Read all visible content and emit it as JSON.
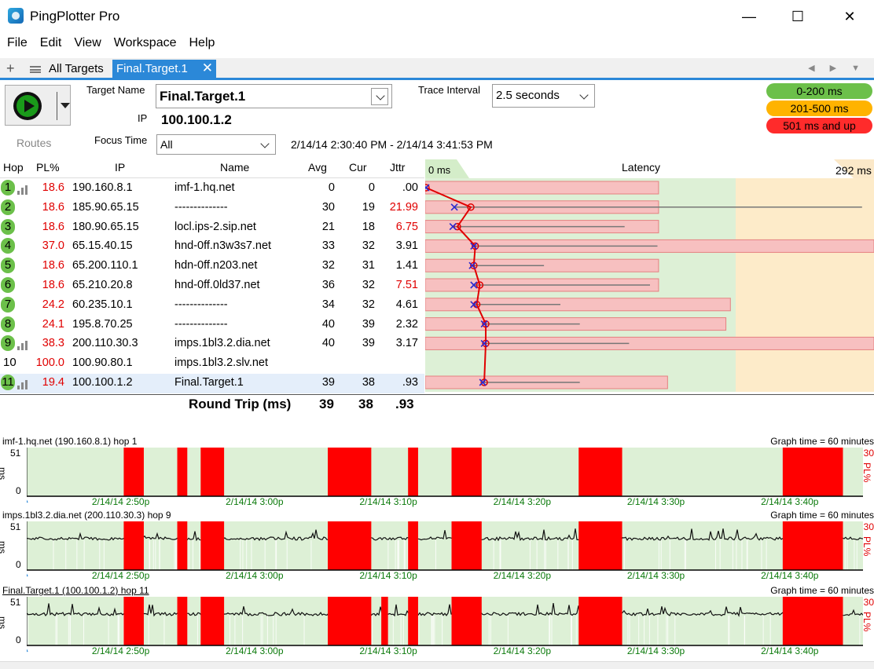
{
  "window": {
    "title": "PingPlotter Pro",
    "controls": {
      "minimize": "—",
      "maximize": "☐",
      "close": "✕"
    }
  },
  "menu": [
    "File",
    "Edit",
    "View",
    "Workspace",
    "Help"
  ],
  "tabs": {
    "add": "+",
    "all_targets": "All Targets",
    "active": "Final.Target.1",
    "close": "✕",
    "nav": "◀ ▶ ▼"
  },
  "target": {
    "routes_label": "Routes",
    "name_label": "Target Name",
    "name_value": "Final.Target.1",
    "ip_label": "IP",
    "ip_value": "100.100.1.2",
    "focus_label": "Focus Time",
    "focus_value": "All",
    "time_range": "2/14/14 2:30:40 PM - 2/14/14 3:41:53 PM",
    "interval_label": "Trace Interval",
    "interval_value": "2.5 seconds"
  },
  "legend": [
    {
      "label": "0-200 ms",
      "color": "#6cc04a"
    },
    {
      "label": "201-500 ms",
      "color": "#ffb300"
    },
    {
      "label": "501 ms and up",
      "color": "#ff2b2b"
    }
  ],
  "table": {
    "headers": {
      "hop": "Hop",
      "pl": "PL%",
      "ip": "IP",
      "name": "Name",
      "avg": "Avg",
      "cur": "Cur",
      "jttr": "Jttr"
    },
    "rows": [
      {
        "hop": "1",
        "pl": "18.6",
        "ip": "190.160.8.1",
        "name": "imf-1.hq.net",
        "avg": "0",
        "cur": "0",
        "jttr": ".00",
        "jttr_red": false,
        "bars": true
      },
      {
        "hop": "2",
        "pl": "18.6",
        "ip": "185.90.65.15",
        "name": "--------------",
        "avg": "30",
        "cur": "19",
        "jttr": "21.99",
        "jttr_red": true,
        "bars": false
      },
      {
        "hop": "3",
        "pl": "18.6",
        "ip": "180.90.65.15",
        "name": "locl.ips-2.sip.net",
        "avg": "21",
        "cur": "18",
        "jttr": "6.75",
        "jttr_red": true,
        "bars": false
      },
      {
        "hop": "4",
        "pl": "37.0",
        "ip": "65.15.40.15",
        "name": "hnd-0ff.n3w3s7.net",
        "avg": "33",
        "cur": "32",
        "jttr": "3.91",
        "jttr_red": false,
        "bars": false
      },
      {
        "hop": "5",
        "pl": "18.6",
        "ip": "65.200.110.1",
        "name": "hdn-0ff.n203.net",
        "avg": "32",
        "cur": "31",
        "jttr": "1.41",
        "jttr_red": false,
        "bars": false
      },
      {
        "hop": "6",
        "pl": "18.6",
        "ip": "65.210.20.8",
        "name": "hnd-0ff.0ld37.net",
        "avg": "36",
        "cur": "32",
        "jttr": "7.51",
        "jttr_red": true,
        "bars": false
      },
      {
        "hop": "7",
        "pl": "24.2",
        "ip": "60.235.10.1",
        "name": "--------------",
        "avg": "34",
        "cur": "32",
        "jttr": "4.61",
        "jttr_red": false,
        "bars": false
      },
      {
        "hop": "8",
        "pl": "24.1",
        "ip": "195.8.70.25",
        "name": "--------------",
        "avg": "40",
        "cur": "39",
        "jttr": "2.32",
        "jttr_red": false,
        "bars": false
      },
      {
        "hop": "9",
        "pl": "38.3",
        "ip": "200.110.30.3",
        "name": "imps.1bl3.2.dia.net",
        "avg": "40",
        "cur": "39",
        "jttr": "3.17",
        "jttr_red": false,
        "bars": true
      },
      {
        "hop": "10",
        "pl": "100.0",
        "ip": "100.90.80.1",
        "name": "imps.1bl3.2.slv.net",
        "avg": "",
        "cur": "",
        "jttr": "",
        "jttr_red": false,
        "bars": false,
        "plain": true
      },
      {
        "hop": "11",
        "pl": "19.4",
        "ip": "100.100.1.2",
        "name": "Final.Target.1",
        "avg": "39",
        "cur": "38",
        "jttr": ".93",
        "jttr_red": false,
        "bars": true,
        "selected": true
      }
    ],
    "round_trip": {
      "label": "Round Trip (ms)",
      "avg": "39",
      "cur": "38",
      "jttr": ".93"
    }
  },
  "latency": {
    "header_left": "0 ms",
    "header_title": "Latency",
    "header_right": "292 ms",
    "max_ms": 292,
    "zone_green_end_ms": 200,
    "pl_bars": [
      52,
      52,
      52,
      100,
      52,
      52,
      68,
      67,
      100,
      0,
      54
    ],
    "points": [
      {
        "avg": 0,
        "cur": 0,
        "min": 0,
        "max": 0
      },
      {
        "avg": 30,
        "cur": 19,
        "min": 19,
        "max": 292
      },
      {
        "avg": 21,
        "cur": 18,
        "min": 18,
        "max": 133
      },
      {
        "avg": 33,
        "cur": 32,
        "min": 32,
        "max": 155
      },
      {
        "avg": 32,
        "cur": 31,
        "min": 31,
        "max": 79
      },
      {
        "avg": 36,
        "cur": 32,
        "min": 32,
        "max": 150
      },
      {
        "avg": 34,
        "cur": 32,
        "min": 32,
        "max": 90
      },
      {
        "avg": 40,
        "cur": 39,
        "min": 39,
        "max": 103
      },
      {
        "avg": 40,
        "cur": 39,
        "min": 39,
        "max": 136
      },
      null,
      {
        "avg": 39,
        "cur": 38,
        "min": 38,
        "max": 103
      }
    ]
  },
  "graphs": [
    {
      "title": "imf-1.hq.net (190.160.8.1) hop 1",
      "graph_time": "Graph time = 60 minutes",
      "y_max": "51",
      "y_min": "0",
      "y_unit": "ms",
      "pl_max": "30",
      "pl_unit": "PL%",
      "loss_blocks": [
        [
          2.9,
          3.5
        ],
        [
          4.5,
          4.8
        ],
        [
          5.2,
          5.9
        ],
        [
          9.0,
          10.3
        ],
        [
          11.4,
          11.7
        ],
        [
          12.7,
          13.6
        ],
        [
          16.5,
          17.8
        ],
        [
          22.6,
          24.4
        ]
      ],
      "x_ticks": [
        "2/14/14 2:50p",
        "2/14/14 3:00p",
        "2/14/14 3:10p",
        "2/14/14 3:20p",
        "2/14/14 3:30p",
        "2/14/14 3:40p"
      ],
      "latency_trace": false
    },
    {
      "title": "imps.1bl3.2.dia.net (200.110.30.3) hop 9",
      "graph_time": "Graph time = 60 minutes",
      "y_max": "51",
      "y_min": "0",
      "y_unit": "ms",
      "pl_max": "30",
      "pl_unit": "PL%",
      "loss_blocks": [
        [
          2.9,
          3.5
        ],
        [
          4.5,
          4.8
        ],
        [
          5.2,
          5.9
        ],
        [
          9.0,
          10.3
        ],
        [
          11.4,
          11.7
        ],
        [
          12.7,
          13.6
        ],
        [
          16.5,
          17.8
        ],
        [
          22.6,
          24.4
        ]
      ],
      "x_ticks": [
        "2/14/14 2:50p",
        "2/14/14 3:00p",
        "2/14/14 3:10p",
        "2/14/14 3:20p",
        "2/14/14 3:30p",
        "2/14/14 3:40p"
      ],
      "latency_trace": true
    },
    {
      "title": "Final.Target.1 (100.100.1.2) hop 11",
      "graph_time": "Graph time = 60 minutes",
      "y_max": "51",
      "y_min": "0",
      "y_unit": "ms",
      "pl_max": "30",
      "pl_unit": "PL%",
      "loss_blocks": [
        [
          2.9,
          3.5
        ],
        [
          4.5,
          4.8
        ],
        [
          5.2,
          5.9
        ],
        [
          9.0,
          10.3
        ],
        [
          10.6,
          10.8
        ],
        [
          11.4,
          11.7
        ],
        [
          12.7,
          13.6
        ],
        [
          16.5,
          17.8
        ],
        [
          22.6,
          24.4
        ]
      ],
      "x_ticks": [
        "2/14/14 2:50p",
        "2/14/14 3:00p",
        "2/14/14 3:10p",
        "2/14/14 3:20p",
        "2/14/14 3:30p",
        "2/14/14 3:40p"
      ],
      "latency_trace": true
    }
  ]
}
